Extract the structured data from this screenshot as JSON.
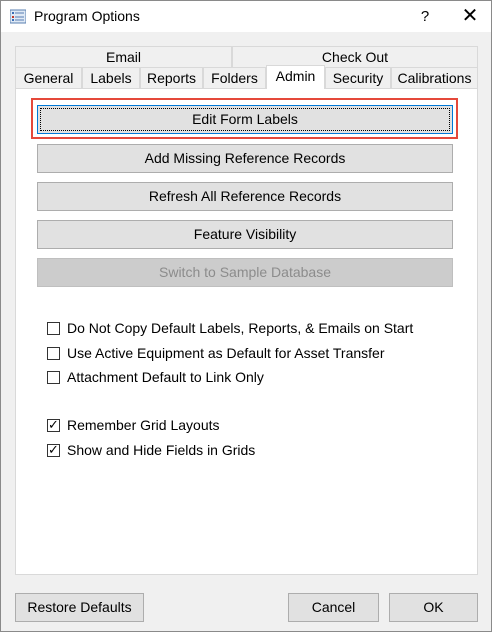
{
  "window": {
    "title": "Program Options",
    "help_label": "?",
    "close_label": "✕"
  },
  "tabs": {
    "row1": [
      {
        "label": "Email"
      },
      {
        "label": "Check Out"
      }
    ],
    "row2": [
      {
        "label": "General"
      },
      {
        "label": "Labels"
      },
      {
        "label": "Reports"
      },
      {
        "label": "Folders"
      },
      {
        "label": "Admin"
      },
      {
        "label": "Security"
      },
      {
        "label": "Calibrations"
      }
    ],
    "active": "Admin"
  },
  "admin": {
    "buttons": [
      {
        "label": "Edit Form Labels",
        "enabled": true,
        "focused": true
      },
      {
        "label": "Add Missing Reference Records",
        "enabled": true
      },
      {
        "label": "Refresh All Reference Records",
        "enabled": true
      },
      {
        "label": "Feature Visibility",
        "enabled": true
      },
      {
        "label": "Switch to Sample Database",
        "enabled": false
      }
    ],
    "checkboxes": [
      {
        "label": "Do Not Copy Default Labels, Reports, & Emails on Start",
        "checked": false
      },
      {
        "label": "Use Active Equipment as Default for Asset Transfer",
        "checked": false
      },
      {
        "label": "Attachment Default to Link Only",
        "checked": false
      },
      {
        "label": "Remember Grid Layouts",
        "checked": true
      },
      {
        "label": "Show and Hide Fields in Grids",
        "checked": true
      }
    ]
  },
  "footer": {
    "restore_label": "Restore Defaults",
    "cancel_label": "Cancel",
    "ok_label": "OK"
  },
  "icons": {
    "check_mark": "✓"
  },
  "colors": {
    "highlight": "#e5483a",
    "focus": "#0078d7"
  }
}
